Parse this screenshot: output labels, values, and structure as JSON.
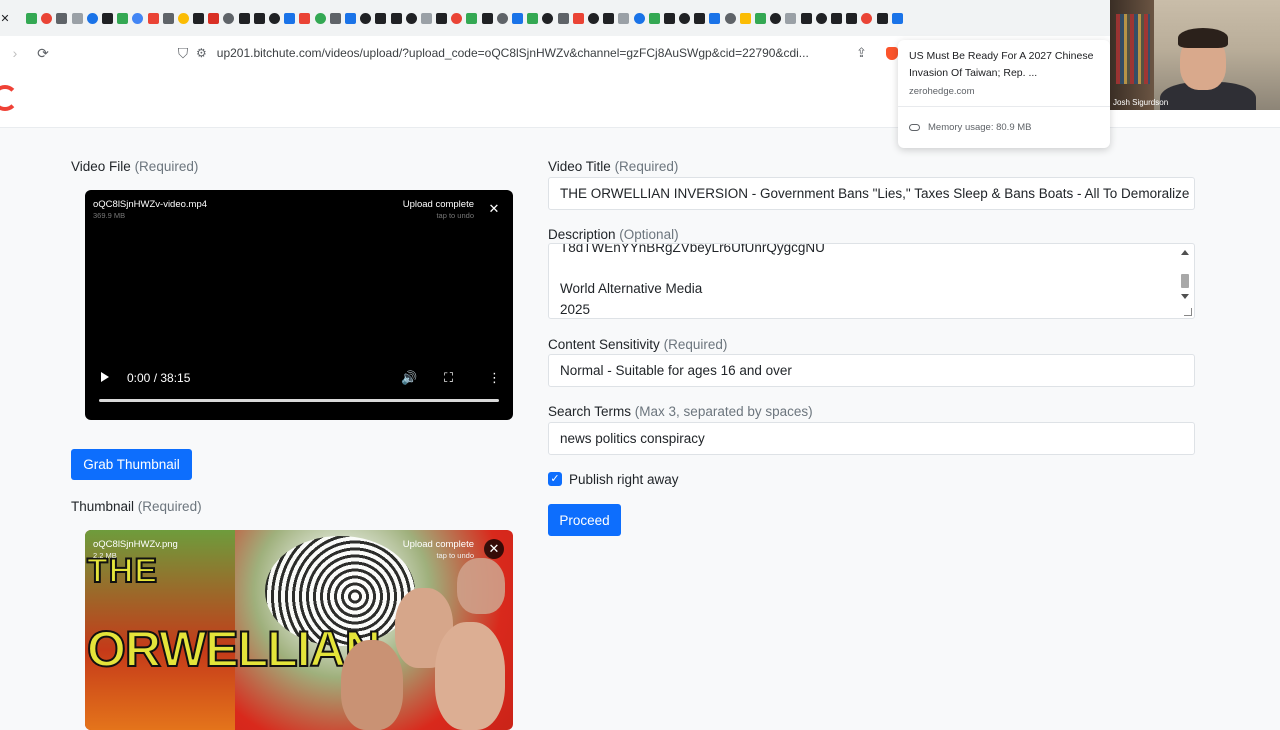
{
  "browser": {
    "url": "up201.bitchute.com/videos/upload/?upload_code=oQC8lSjnHWZv&channel=gzFCj8AuSWgp&cid=22790&cdi...",
    "favicon_colors": [
      "#34a853",
      "#ea4335",
      "#5f6368",
      "#9aa0a6",
      "#1a73e8",
      "#202124",
      "#34a853",
      "#4285f4",
      "#ea4335",
      "#5f6368",
      "#fbbc04",
      "#202124",
      "#d93025",
      "#5f6368",
      "#202124",
      "#202124",
      "#202124",
      "#1a73e8",
      "#ea4335",
      "#34a853",
      "#5f6368",
      "#1a73e8",
      "#202124",
      "#202124",
      "#202124",
      "#202124",
      "#9aa0a6",
      "#202124",
      "#ea4335",
      "#34a853",
      "#202124",
      "#5f6368",
      "#1a73e8",
      "#34a853",
      "#202124",
      "#5f6368",
      "#ea4335",
      "#202124",
      "#202124",
      "#9aa0a6",
      "#1a73e8",
      "#34a853",
      "#202124",
      "#202124",
      "#202124",
      "#1a73e8",
      "#5f6368",
      "#fbbc04",
      "#34a853",
      "#202124",
      "#9aa0a6",
      "#202124",
      "#202124",
      "#202124",
      "#202124",
      "#ea4335",
      "#202124",
      "#1a73e8"
    ]
  },
  "hover_card": {
    "title": "US Must Be Ready For A 2027 Chinese Invasion Of Taiwan; Rep. ...",
    "domain": "zerohedge.com",
    "memory": "Memory usage: 80.9 MB"
  },
  "webcam": {
    "name": "Josh Sigurdson"
  },
  "video_file": {
    "label": "Video File",
    "required": "(Required)",
    "filename": "oQC8lSjnHWZv-video.mp4",
    "size": "369.9 MB",
    "status": "Upload complete",
    "undo": "tap to undo",
    "time": "0:00 / 38:15"
  },
  "grab_thumbnail_label": "Grab Thumbnail",
  "thumbnail": {
    "label": "Thumbnail",
    "required": "(Required)",
    "filename": "oQC8lSjnHWZv.png",
    "size": "2.2 MB",
    "status": "Upload complete",
    "undo": "tap to undo",
    "text_line1": "THE",
    "text_line2": "ORWELLIAN"
  },
  "video_title": {
    "label": "Video Title",
    "required": "(Required)",
    "value": "THE ORWELLIAN INVERSION - Government Bans \"Lies,\" Taxes Sleep & Bans Boats - All To Demoralize"
  },
  "description": {
    "label": "Description",
    "optional": "(Optional)",
    "lines": [
      "T8dTWEnYYnBRgZVbeyLr6UfUnrQygcgNU",
      "",
      "World Alternative Media",
      "2025"
    ]
  },
  "content_sensitivity": {
    "label": "Content Sensitivity",
    "required": "(Required)",
    "value": "Normal - Suitable for ages 16 and over"
  },
  "search_terms": {
    "label": "Search Terms",
    "hint": "(Max 3, separated by spaces)",
    "value": "news politics conspiracy"
  },
  "publish": {
    "label": "Publish right away",
    "checked": true
  },
  "proceed_label": "Proceed",
  "colors": {
    "primary": "#0d6efd",
    "logo": "#ef4136"
  }
}
